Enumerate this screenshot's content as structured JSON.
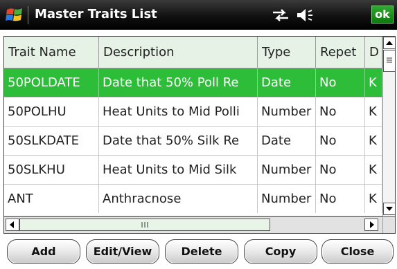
{
  "window": {
    "title": "Master Traits List",
    "ok_label": "ok"
  },
  "icons": {
    "start": "windows-start-icon",
    "connectivity": "connectivity-icon",
    "volume": "volume-icon"
  },
  "table": {
    "columns": [
      "Trait Name",
      "Description",
      "Type",
      "Repet",
      "D"
    ],
    "rows": [
      {
        "name": "50POLDATE",
        "description": "Date that 50% Poll Re",
        "type": "Date",
        "repet": "No",
        "d": "K",
        "selected": true
      },
      {
        "name": "50POLHU",
        "description": "Heat Units to Mid Polli",
        "type": "Number",
        "repet": "No",
        "d": "K",
        "selected": false
      },
      {
        "name": "50SLKDATE",
        "description": "Date that 50% Silk Re",
        "type": "Date",
        "repet": "No",
        "d": "K",
        "selected": false
      },
      {
        "name": "50SLKHU",
        "description": "Heat Units to Mid Silk",
        "type": "Number",
        "repet": "No",
        "d": "K",
        "selected": false
      },
      {
        "name": "ANT",
        "description": "Anthracnose",
        "type": "Number",
        "repet": "No",
        "d": "K",
        "selected": false
      }
    ]
  },
  "buttons": {
    "add": "Add",
    "edit_view": "Edit/View",
    "delete": "Delete",
    "copy": "Copy",
    "close": "Close"
  },
  "colors": {
    "selected_row": "#2ebd39",
    "header_bg": "#e6f2e6",
    "titlebar": "#111111",
    "ok_button": "#0d7a0d"
  }
}
